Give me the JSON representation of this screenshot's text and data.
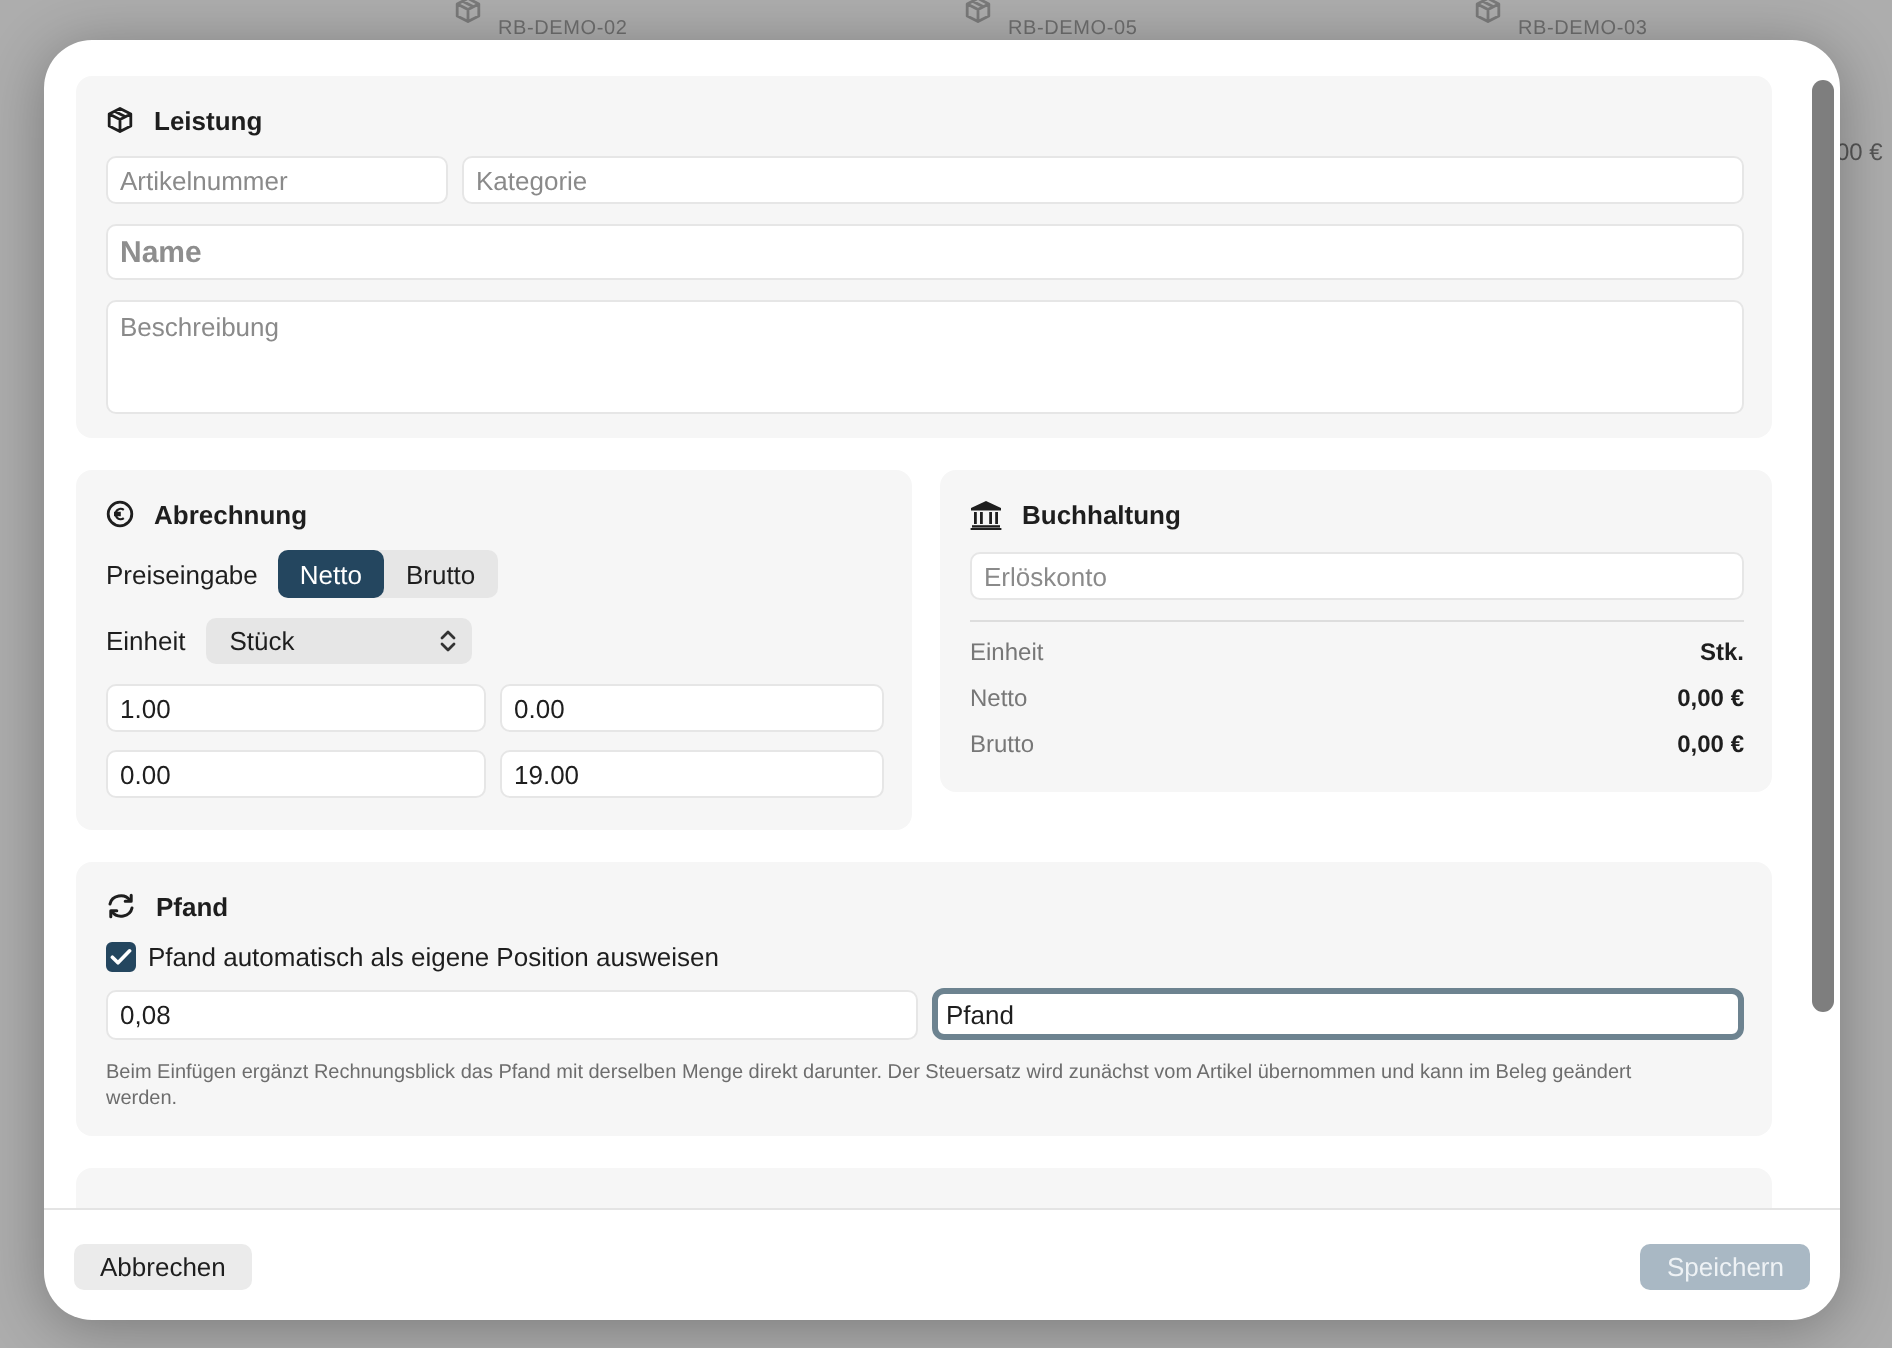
{
  "background": {
    "items": [
      {
        "code": "RB-DEMO-02"
      },
      {
        "code": "RB-DEMO-05"
      },
      {
        "code": "RB-DEMO-03"
      }
    ],
    "price_fragment": "00 €"
  },
  "dialog": {
    "leistung": {
      "title": "Leistung",
      "article_number": {
        "placeholder": "Artikelnummer"
      },
      "category": {
        "placeholder": "Kategorie"
      },
      "name": {
        "placeholder": "Name"
      },
      "description": {
        "placeholder": "Beschreibung"
      }
    },
    "abrechnung": {
      "title": "Abrechnung",
      "price_input_label": "Preiseingabe",
      "price_input_options": [
        {
          "label": "Netto",
          "selected": true
        },
        {
          "label": "Brutto",
          "selected": false
        }
      ],
      "unit_label": "Einheit",
      "unit_value": "Stück",
      "fields": [
        {
          "value": "1.00"
        },
        {
          "value": "0.00"
        },
        {
          "value": "0.00"
        },
        {
          "value": "19.00"
        }
      ]
    },
    "buchhaltung": {
      "title": "Buchhaltung",
      "revenue_account": {
        "placeholder": "Erlöskonto"
      },
      "summary": [
        {
          "label": "Einheit",
          "value": "Stk."
        },
        {
          "label": "Netto",
          "value": "0,00 €"
        },
        {
          "label": "Brutto",
          "value": "0,00 €"
        }
      ]
    },
    "pfand": {
      "title": "Pfand",
      "checkbox": {
        "label": "Pfand automatisch als eigene Position ausweisen",
        "checked": true
      },
      "amount": {
        "value": "0,08",
        "focused": false
      },
      "name": {
        "value": "Pfand",
        "focused": true
      },
      "hint": "Beim Einfügen ergänzt Rechnungsblick das Pfand mit derselben Menge direkt darunter. Der Steuersatz wird zunächst vom Artikel übernommen und kann im Beleg geändert werden."
    },
    "footer": {
      "cancel": {
        "label": "Abbrechen",
        "disabled": false
      },
      "save": {
        "label": "Speichern",
        "disabled": true
      }
    }
  }
}
